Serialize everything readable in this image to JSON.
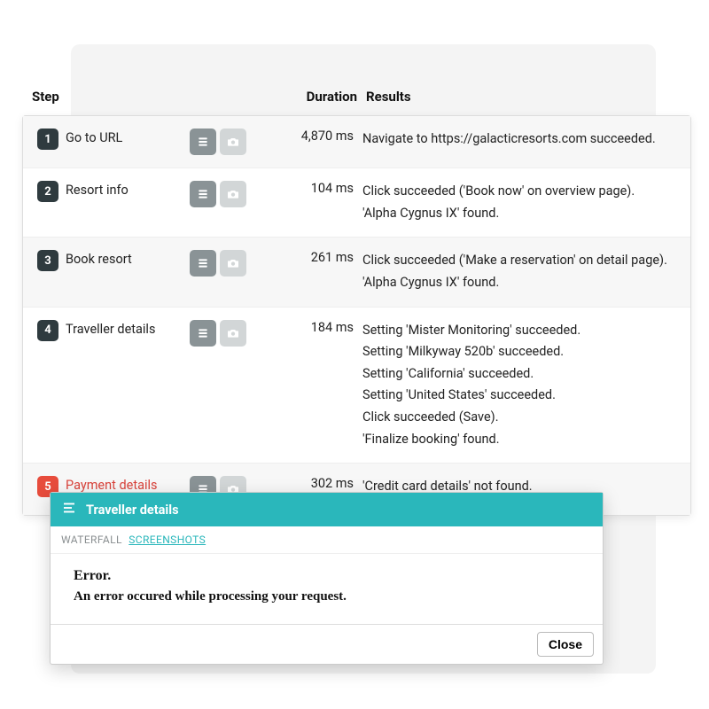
{
  "headers": {
    "step": "Step",
    "duration": "Duration",
    "results": "Results"
  },
  "rows": [
    {
      "num": "1",
      "name": "Go to URL",
      "duration": "4,870 ms",
      "error": false,
      "results": [
        "Navigate to https://galacticresorts.com succeeded."
      ]
    },
    {
      "num": "2",
      "name": "Resort info",
      "duration": "104 ms",
      "error": false,
      "results": [
        "Click succeeded ('Book now' on overview page).",
        "'Alpha Cygnus IX' found."
      ]
    },
    {
      "num": "3",
      "name": "Book resort",
      "duration": "261 ms",
      "error": false,
      "results": [
        "Click succeeded ('Make a reservation' on detail page).",
        "'Alpha Cygnus IX' found."
      ]
    },
    {
      "num": "4",
      "name": "Traveller details",
      "duration": "184 ms",
      "error": false,
      "results": [
        "Setting 'Mister Monitoring' succeeded.",
        "Setting 'Milkyway 520b' succeeded.",
        "Setting 'California' succeeded.",
        "Setting 'United States' succeeded.",
        "Click succeeded (Save).",
        "'Finalize booking' found."
      ]
    },
    {
      "num": "5",
      "name": "Payment details",
      "duration": "302 ms",
      "error": true,
      "results": [
        "'Credit card details' not found."
      ]
    }
  ],
  "dialog": {
    "title": "Traveller details",
    "tabs": {
      "waterfall": "WATERFALL",
      "screenshots": "SCREENSHOTS"
    },
    "error_heading": "Error.",
    "error_body": "An error occured while processing your request.",
    "close": "Close"
  },
  "colors": {
    "teal": "#2ab7bb",
    "error": "#e74c3c"
  }
}
